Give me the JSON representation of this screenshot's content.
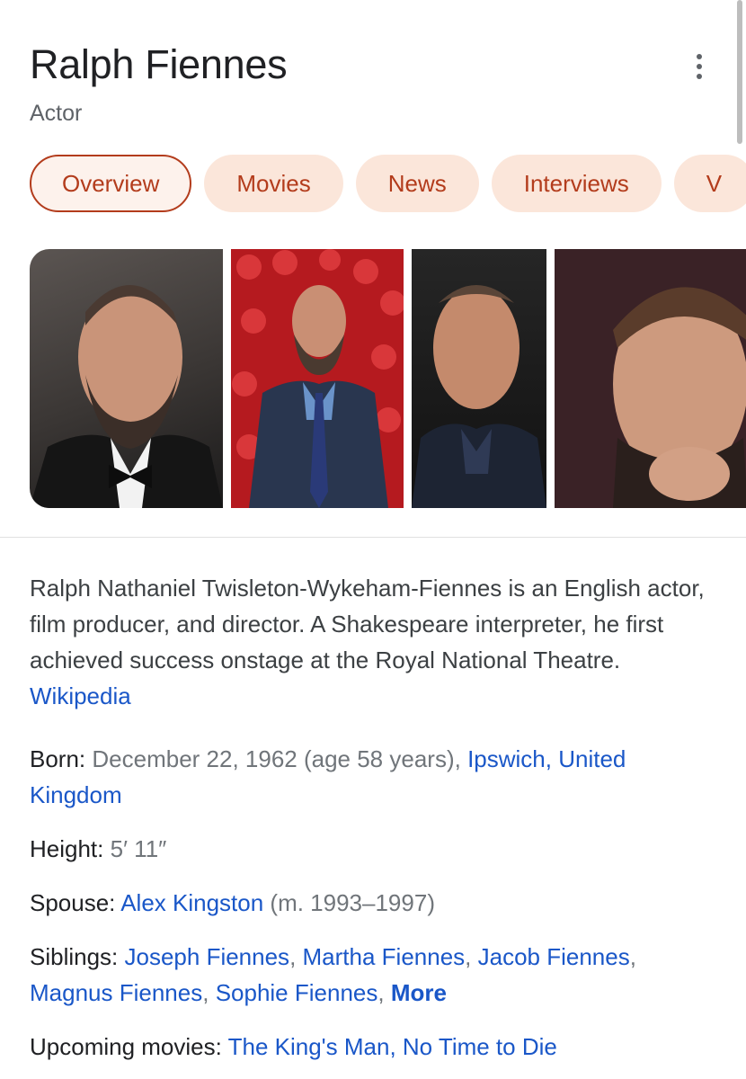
{
  "entity": {
    "name": "Ralph Fiennes",
    "type": "Actor"
  },
  "tabs": [
    {
      "label": "Overview",
      "active": true
    },
    {
      "label": "Movies",
      "active": false
    },
    {
      "label": "News",
      "active": false
    },
    {
      "label": "Interviews",
      "active": false
    },
    {
      "label": "V",
      "active": false
    }
  ],
  "images": [
    {
      "alt": "Ralph Fiennes in tuxedo and bow tie"
    },
    {
      "alt": "Ralph Fiennes in blue suit in front of red roses"
    },
    {
      "alt": "Ralph Fiennes smiling, dark shirt"
    },
    {
      "alt": "Ralph Fiennes younger portrait, hand on chin"
    }
  ],
  "description": {
    "text": "Ralph Nathaniel Twisleton-Wykeham-Fiennes is an English actor, film producer, and director. A Shakespeare interpreter, he first achieved success onstage at the Royal National Theatre. ",
    "source": "Wikipedia"
  },
  "facts": {
    "born": {
      "label": "Born: ",
      "value": "December 22, 1962 (age 58 years), ",
      "place1": "Ipswich",
      "sep": ", ",
      "place2": "United Kingdom"
    },
    "height": {
      "label": "Height: ",
      "value": "5′ 11″"
    },
    "spouse": {
      "label": "Spouse: ",
      "name": "Alex Kingston",
      "years": " (m. 1993–1997)"
    },
    "siblings": {
      "label": "Siblings: ",
      "names": [
        "Joseph Fiennes",
        "Martha Fiennes",
        "Jacob Fiennes",
        "Magnus Fiennes",
        "Sophie Fiennes"
      ],
      "more": "More"
    },
    "upcoming": {
      "label": "Upcoming movies: ",
      "movies": [
        "The King's Man",
        "No Time to Die"
      ]
    }
  },
  "colors": {
    "tab_bg": "#fbe6da",
    "tab_text": "#b33c1c",
    "link": "#1a57c8"
  }
}
